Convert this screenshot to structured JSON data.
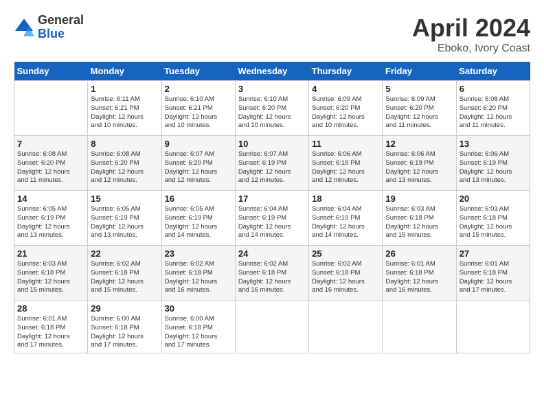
{
  "header": {
    "logo_general": "General",
    "logo_blue": "Blue",
    "month_title": "April 2024",
    "location": "Eboko, Ivory Coast"
  },
  "days_of_week": [
    "Sunday",
    "Monday",
    "Tuesday",
    "Wednesday",
    "Thursday",
    "Friday",
    "Saturday"
  ],
  "weeks": [
    [
      {
        "day": "",
        "info": ""
      },
      {
        "day": "1",
        "info": "Sunrise: 6:11 AM\nSunset: 6:21 PM\nDaylight: 12 hours\nand 10 minutes."
      },
      {
        "day": "2",
        "info": "Sunrise: 6:10 AM\nSunset: 6:21 PM\nDaylight: 12 hours\nand 10 minutes."
      },
      {
        "day": "3",
        "info": "Sunrise: 6:10 AM\nSunset: 6:20 PM\nDaylight: 12 hours\nand 10 minutes."
      },
      {
        "day": "4",
        "info": "Sunrise: 6:09 AM\nSunset: 6:20 PM\nDaylight: 12 hours\nand 10 minutes."
      },
      {
        "day": "5",
        "info": "Sunrise: 6:09 AM\nSunset: 6:20 PM\nDaylight: 12 hours\nand 11 minutes."
      },
      {
        "day": "6",
        "info": "Sunrise: 6:08 AM\nSunset: 6:20 PM\nDaylight: 12 hours\nand 11 minutes."
      }
    ],
    [
      {
        "day": "7",
        "info": "Sunrise: 6:08 AM\nSunset: 6:20 PM\nDaylight: 12 hours\nand 11 minutes."
      },
      {
        "day": "8",
        "info": "Sunrise: 6:08 AM\nSunset: 6:20 PM\nDaylight: 12 hours\nand 12 minutes."
      },
      {
        "day": "9",
        "info": "Sunrise: 6:07 AM\nSunset: 6:20 PM\nDaylight: 12 hours\nand 12 minutes."
      },
      {
        "day": "10",
        "info": "Sunrise: 6:07 AM\nSunset: 6:19 PM\nDaylight: 12 hours\nand 12 minutes."
      },
      {
        "day": "11",
        "info": "Sunrise: 6:06 AM\nSunset: 6:19 PM\nDaylight: 12 hours\nand 12 minutes."
      },
      {
        "day": "12",
        "info": "Sunrise: 6:06 AM\nSunset: 6:19 PM\nDaylight: 12 hours\nand 13 minutes."
      },
      {
        "day": "13",
        "info": "Sunrise: 6:06 AM\nSunset: 6:19 PM\nDaylight: 12 hours\nand 13 minutes."
      }
    ],
    [
      {
        "day": "14",
        "info": "Sunrise: 6:05 AM\nSunset: 6:19 PM\nDaylight: 12 hours\nand 13 minutes."
      },
      {
        "day": "15",
        "info": "Sunrise: 6:05 AM\nSunset: 6:19 PM\nDaylight: 12 hours\nand 13 minutes."
      },
      {
        "day": "16",
        "info": "Sunrise: 6:05 AM\nSunset: 6:19 PM\nDaylight: 12 hours\nand 14 minutes."
      },
      {
        "day": "17",
        "info": "Sunrise: 6:04 AM\nSunset: 6:19 PM\nDaylight: 12 hours\nand 14 minutes."
      },
      {
        "day": "18",
        "info": "Sunrise: 6:04 AM\nSunset: 6:19 PM\nDaylight: 12 hours\nand 14 minutes."
      },
      {
        "day": "19",
        "info": "Sunrise: 6:03 AM\nSunset: 6:18 PM\nDaylight: 12 hours\nand 15 minutes."
      },
      {
        "day": "20",
        "info": "Sunrise: 6:03 AM\nSunset: 6:18 PM\nDaylight: 12 hours\nand 15 minutes."
      }
    ],
    [
      {
        "day": "21",
        "info": "Sunrise: 6:03 AM\nSunset: 6:18 PM\nDaylight: 12 hours\nand 15 minutes."
      },
      {
        "day": "22",
        "info": "Sunrise: 6:02 AM\nSunset: 6:18 PM\nDaylight: 12 hours\nand 15 minutes."
      },
      {
        "day": "23",
        "info": "Sunrise: 6:02 AM\nSunset: 6:18 PM\nDaylight: 12 hours\nand 16 minutes."
      },
      {
        "day": "24",
        "info": "Sunrise: 6:02 AM\nSunset: 6:18 PM\nDaylight: 12 hours\nand 16 minutes."
      },
      {
        "day": "25",
        "info": "Sunrise: 6:02 AM\nSunset: 6:18 PM\nDaylight: 12 hours\nand 16 minutes."
      },
      {
        "day": "26",
        "info": "Sunrise: 6:01 AM\nSunset: 6:18 PM\nDaylight: 12 hours\nand 16 minutes."
      },
      {
        "day": "27",
        "info": "Sunrise: 6:01 AM\nSunset: 6:18 PM\nDaylight: 12 hours\nand 17 minutes."
      }
    ],
    [
      {
        "day": "28",
        "info": "Sunrise: 6:01 AM\nSunset: 6:18 PM\nDaylight: 12 hours\nand 17 minutes."
      },
      {
        "day": "29",
        "info": "Sunrise: 6:00 AM\nSunset: 6:18 PM\nDaylight: 12 hours\nand 17 minutes."
      },
      {
        "day": "30",
        "info": "Sunrise: 6:00 AM\nSunset: 6:18 PM\nDaylight: 12 hours\nand 17 minutes."
      },
      {
        "day": "",
        "info": ""
      },
      {
        "day": "",
        "info": ""
      },
      {
        "day": "",
        "info": ""
      },
      {
        "day": "",
        "info": ""
      }
    ]
  ]
}
